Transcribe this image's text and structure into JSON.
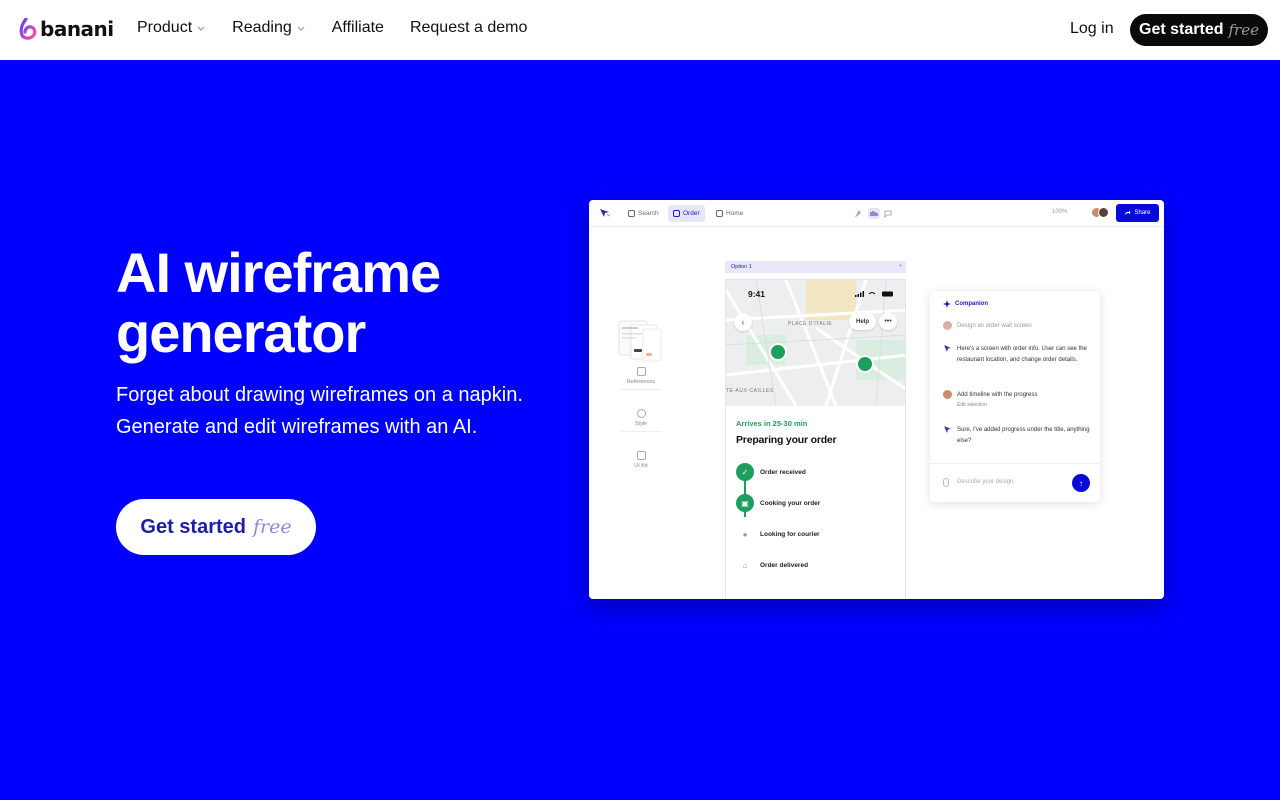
{
  "brand": {
    "name": "banani"
  },
  "nav": {
    "links": [
      {
        "label": "Product",
        "dropdown": true
      },
      {
        "label": "Reading",
        "dropdown": true
      },
      {
        "label": "Affiliate",
        "dropdown": false
      },
      {
        "label": "Request a demo",
        "dropdown": false
      }
    ],
    "login_label": "Log in",
    "cta": {
      "label": "Get started",
      "accent": "free"
    }
  },
  "hero": {
    "title": "AI wireframe generator",
    "subtitle": "Forget about drawing wireframes on a napkin. Generate and edit wireframes with an AI.",
    "cta": {
      "label": "Get started",
      "accent": "free"
    }
  },
  "mock": {
    "tabs": [
      "Search",
      "Order",
      "Home"
    ],
    "active_tab": "Order",
    "zoom": "100%",
    "share_label": "Share",
    "sidebar": [
      "References",
      "Style",
      "UI Kit"
    ],
    "option_label": "Option 1",
    "phone": {
      "time": "9:41",
      "help_label": "Help",
      "more_label": "•••",
      "street_1": "PLACE D'ITALIE",
      "street_2": "TE-AUX-CAILLES",
      "eta": "Arrives in 25-30 min",
      "title": "Preparing your order",
      "steps": [
        {
          "label": "Order received",
          "done": true
        },
        {
          "label": "Cooking your order",
          "done": true
        },
        {
          "label": "Looking for courier",
          "done": false
        },
        {
          "label": "Order delivered",
          "done": false
        }
      ]
    },
    "companion": {
      "title": "Companion",
      "messages": [
        {
          "text": "Design an order wait screen",
          "from": "user",
          "muted": true
        },
        {
          "text": "Here's a screen with order info. User can see the restaurant location, and change order details.",
          "from": "ai"
        },
        {
          "text": "Add timeline with the progress",
          "sub": "Edit selection",
          "from": "user"
        },
        {
          "text": "Sure, I've added progress under the title, anything else?",
          "from": "ai"
        }
      ],
      "placeholder": "Describe your design"
    }
  },
  "colors": {
    "hero_bg": "#0000ff",
    "accent_green": "#1e9e5e",
    "accent_blue": "#0a0ad8"
  }
}
